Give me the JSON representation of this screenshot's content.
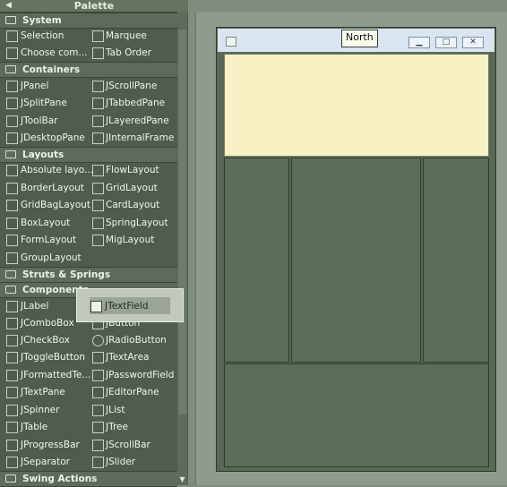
{
  "palette": {
    "title": "Palette",
    "categories": {
      "system": "System",
      "containers": "Containers",
      "layouts": "Layouts",
      "struts": "Struts & Springs",
      "components": "Components",
      "swing_actions": "Swing Actions"
    },
    "system_items": [
      "Selection",
      "Choose com...",
      "Marquee",
      "Tab Order"
    ],
    "container_items": [
      "JPanel",
      "JScrollPane",
      "JSplitPane",
      "JTabbedPane",
      "JToolBar",
      "JLayeredPane",
      "JDesktopPane",
      "JInternalFrame"
    ],
    "layout_items": [
      "Absolute layo...",
      "FlowLayout",
      "BorderLayout",
      "GridLayout",
      "GridBagLayout",
      "CardLayout",
      "BoxLayout",
      "SpringLayout",
      "FormLayout",
      "MigLayout",
      "GroupLayout"
    ],
    "component_items": [
      "JLabel",
      "JComboBox",
      "JButton",
      "JCheckBox",
      "JRadioButton",
      "JToggleButton",
      "JTextArea",
      "JFormattedTe...",
      "JPasswordField",
      "JTextPane",
      "JEditorPane",
      "JSpinner",
      "JList",
      "JTable",
      "JTree",
      "JProgressBar",
      "JScrollBar",
      "JSeparator",
      "JSlider"
    ],
    "dragging_item": "JTextField"
  },
  "design": {
    "tooltip": "North"
  },
  "colors": {
    "north_highlight": "#f7f1c4",
    "titlebar": "#d9e5f0"
  }
}
